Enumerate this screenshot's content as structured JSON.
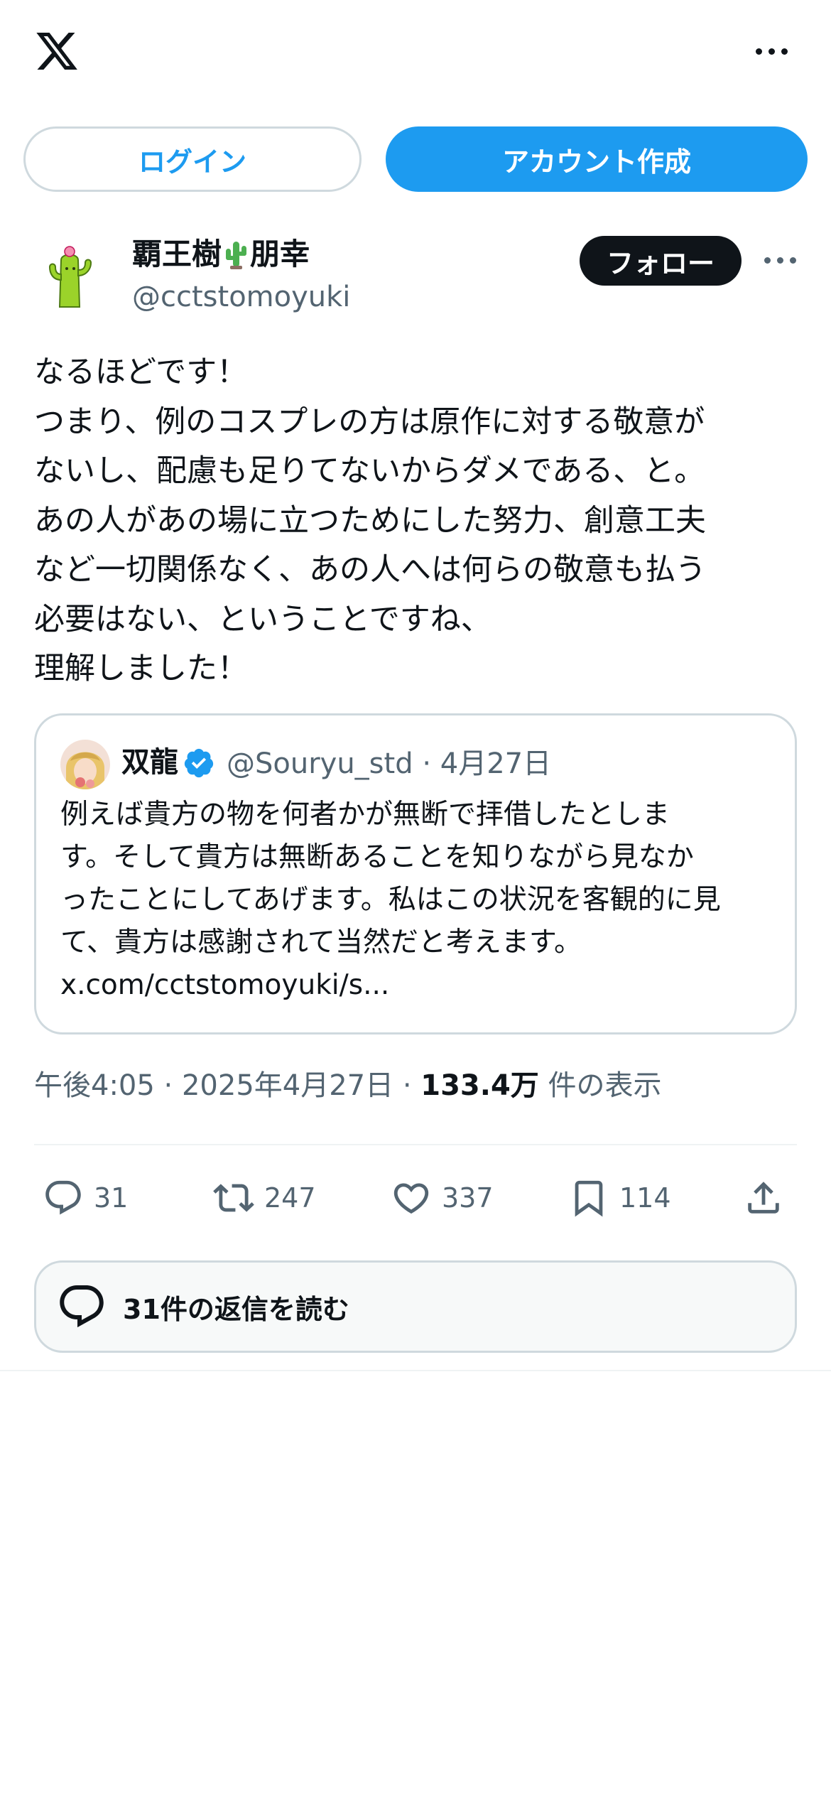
{
  "header": {
    "logo": "x-logo",
    "more": "more-icon"
  },
  "auth": {
    "login_label": "ログイン",
    "signup_label": "アカウント作成"
  },
  "author": {
    "name_part1": "覇王樹",
    "name_emoji": "cactus-emoji",
    "name_part2": "朋幸",
    "handle": "@cctstomoyuki",
    "follow_label": "フォロー"
  },
  "tweet": {
    "lines": [
      "なるほどです！",
      "つまり、例のコスプレの方は原作に対する敬意が",
      "ないし、配慮も足りてないからダメである、と。",
      "あの人があの場に立つためにした努力、創意工夫",
      "など一切関係なく、あの人へは何らの敬意も払う",
      "必要はない、ということですね、",
      "理解しました！"
    ]
  },
  "quote": {
    "name": "双龍",
    "handle_date": "@Souryu_std · 4月27日",
    "lines": [
      "例えば貴方の物を何者かが無断で拝借したとしま",
      "す。そして貴方は無断あることを知りながら見なか",
      "ったことにしてあげます。私はこの状況を客観的に見",
      "て、貴方は感謝されて当然だと考えます。",
      "x.com/cctstomoyuki/s..."
    ]
  },
  "meta": {
    "time_date": "午後4:05 · 2025年4月27日 · ",
    "views": "133.4万",
    "views_suffix": " 件の表示"
  },
  "actions": {
    "reply_count": "31",
    "retweet_count": "247",
    "like_count": "337",
    "bookmark_count": "114"
  },
  "replies_button": {
    "label": "31件の返信を読む"
  },
  "colors": {
    "accent": "#1d9bf0",
    "text": "#0f1419",
    "secondary": "#536471",
    "border": "#cfd9de"
  }
}
